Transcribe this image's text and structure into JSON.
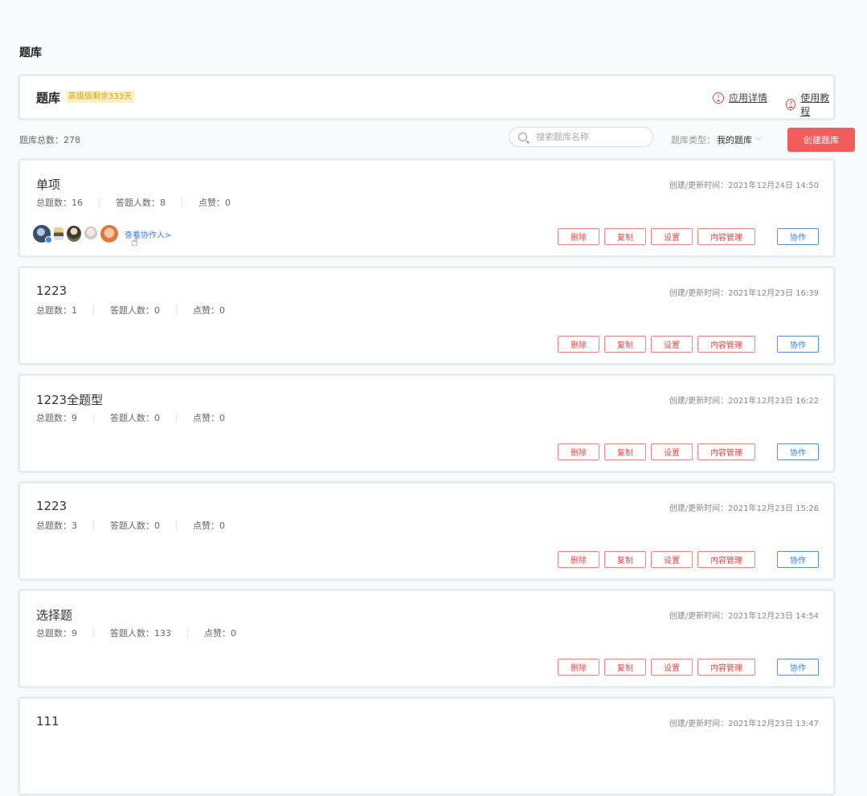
{
  "page": {
    "heading": "题库"
  },
  "header": {
    "title": "题库",
    "badge": "高级版剩余333天",
    "app_detail": "应用详情",
    "tutorial": "使用教程"
  },
  "toolbar": {
    "count_label": "题库总数：278",
    "search_placeholder": "搜索题库名称",
    "type_label": "题库类型：",
    "type_value": "我的题库",
    "create_button": "创建题库"
  },
  "labels": {
    "total": "总题数：",
    "answerers": "答题人数：",
    "likes": "点赞：",
    "time_prefix": "创建/更新时间：",
    "view_collaborators": "查看协作人>"
  },
  "actions": {
    "delete": "删除",
    "copy": "复制",
    "settings": "设置",
    "content": "内容管理",
    "collaborate": "协作"
  },
  "banks": [
    {
      "name": "单项",
      "total": "16",
      "answerers": "8",
      "likes": "0",
      "time": "2021年12月24日 14:50"
    },
    {
      "name": "1223",
      "total": "1",
      "answerers": "0",
      "likes": "0",
      "time": "2021年12月23日 16:39"
    },
    {
      "name": "1223全题型",
      "total": "9",
      "answerers": "0",
      "likes": "0",
      "time": "2021年12月23日 16:22"
    },
    {
      "name": "1223",
      "total": "3",
      "answerers": "0",
      "likes": "0",
      "time": "2021年12月23日 15:26"
    },
    {
      "name": "选择题",
      "total": "9",
      "answerers": "133",
      "likes": "0",
      "time": "2021年12月23日 14:54"
    },
    {
      "name": "111",
      "time": "2021年12月23日 13:47"
    }
  ]
}
